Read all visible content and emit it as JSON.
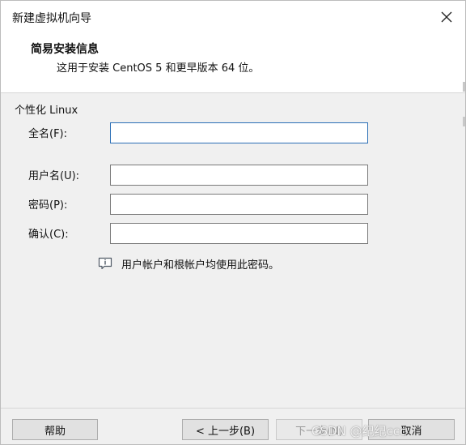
{
  "window": {
    "title": "新建虚拟机向导"
  },
  "header": {
    "title": "简易安装信息",
    "subtitle": "这用于安装 CentOS 5 和更早版本 64 位。"
  },
  "section": {
    "label": "个性化 Linux"
  },
  "fields": {
    "full_name": {
      "label": "全名(F):",
      "value": ""
    },
    "username": {
      "label": "用户名(U):",
      "value": ""
    },
    "password": {
      "label": "密码(P):",
      "value": ""
    },
    "confirm": {
      "label": "确认(C):",
      "value": ""
    }
  },
  "info": {
    "icon": "info-bubble-icon",
    "text": "用户帐户和根帐户均使用此密码。"
  },
  "buttons": {
    "help": "帮助",
    "back": "< 上一步(B)",
    "next": "下一步(N)",
    "cancel": "取消"
  },
  "watermark": {
    "text": "CSDN @纪纪ccc"
  },
  "colors": {
    "focus_border": "#2b6fb6",
    "input_border": "#7a7a7a",
    "dialog_bg": "#f0f0f0"
  }
}
